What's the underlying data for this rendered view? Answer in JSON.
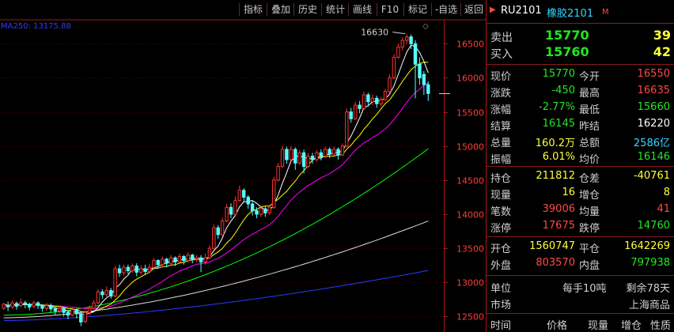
{
  "toolbar": {
    "items": [
      "指标",
      "叠加",
      "历史",
      "统计",
      "画线",
      "F10",
      "标记",
      "-自选",
      "返回"
    ]
  },
  "instrument": {
    "code": "RU2101",
    "name": "橡胶2101",
    "flag": "M"
  },
  "orderbook": {
    "sell_label": "卖出",
    "sell_price": "15770",
    "sell_vol": "39",
    "buy_label": "买入",
    "buy_price": "15760",
    "buy_vol": "42"
  },
  "quote": [
    {
      "l1": "现价",
      "v1": "15770",
      "c1": "green",
      "l2": "今开",
      "v2": "16550",
      "c2": "red"
    },
    {
      "l1": "涨跌",
      "v1": "-450",
      "c1": "green",
      "l2": "最高",
      "v2": "16635",
      "c2": "red"
    },
    {
      "l1": "涨幅",
      "v1": "-2.77%",
      "c1": "green",
      "l2": "最低",
      "v2": "15660",
      "c2": "green"
    },
    {
      "l1": "结算",
      "v1": "16145",
      "c1": "green",
      "l2": "昨结",
      "v2": "16220",
      "c2": "white"
    },
    {
      "l1": "总量",
      "v1": "160.2万",
      "c1": "yellow",
      "l2": "总额",
      "v2": "2586亿",
      "c2": "cyan"
    },
    {
      "l1": "振幅",
      "v1": "6.01%",
      "c1": "yellow",
      "l2": "均价",
      "v2": "16146",
      "c2": "green"
    }
  ],
  "position": [
    {
      "l1": "持仓",
      "v1": "211812",
      "c1": "yellow",
      "l2": "仓差",
      "v2": "-40761",
      "c2": "yellow"
    },
    {
      "l1": "现量",
      "v1": "16",
      "c1": "yellow",
      "l2": "增仓",
      "v2": "8",
      "c2": "yellow"
    },
    {
      "l1": "笔数",
      "v1": "39006",
      "c1": "red",
      "l2": "均量",
      "v2": "41",
      "c2": "red"
    },
    {
      "l1": "涨停",
      "v1": "17675",
      "c1": "red",
      "l2": "跌停",
      "v2": "14760",
      "c2": "green"
    }
  ],
  "trade": [
    {
      "l1": "开仓",
      "v1": "1560747",
      "c1": "yellow",
      "l2": "平仓",
      "v2": "1642269",
      "c2": "yellow"
    },
    {
      "l1": "外盘",
      "v1": "803570",
      "c1": "red",
      "l2": "内盘",
      "v2": "797938",
      "c2": "green"
    }
  ],
  "info": {
    "unit_label": "单位",
    "unit_value": "每手10吨",
    "remain_value": "剩余78天",
    "market_label": "市场",
    "market_value": "上海商品"
  },
  "ticks_header": [
    "时间",
    "价格",
    "现量",
    "增仓",
    "性质"
  ],
  "colors": {
    "up": "#ff3232",
    "down": "#54ffff",
    "ma5": "#ffffff",
    "ma10": "#ffff00",
    "ma20": "#ff00ff",
    "ma60": "#00ff00",
    "ma120": "#dcdcdc",
    "ma250": "#2a3cff",
    "border": "#b01414"
  },
  "chart_data": {
    "type": "candlestick",
    "ma_label": "MA250: 13175.88",
    "high_marker": "16630",
    "y_ticks": [
      12500,
      13000,
      13500,
      14000,
      14500,
      15000,
      15500,
      16000,
      16500
    ],
    "ylim": [
      12330,
      16840
    ],
    "last_price": 15770,
    "candles": [
      [
        12620,
        12680,
        12600,
        12700
      ],
      [
        12660,
        12640,
        12580,
        12720
      ],
      [
        12640,
        12700,
        12610,
        12740
      ],
      [
        12690,
        12650,
        12600,
        12720
      ],
      [
        12660,
        12700,
        12630,
        12760
      ],
      [
        12700,
        12680,
        12620,
        12730
      ],
      [
        12680,
        12640,
        12590,
        12700
      ],
      [
        12650,
        12700,
        12620,
        12730
      ],
      [
        12700,
        12660,
        12610,
        12720
      ],
      [
        12660,
        12620,
        12570,
        12680
      ],
      [
        12620,
        12660,
        12580,
        12700
      ],
      [
        12660,
        12610,
        12560,
        12690
      ],
      [
        12610,
        12580,
        12520,
        12640
      ],
      [
        12580,
        12620,
        12540,
        12660
      ],
      [
        12620,
        12560,
        12500,
        12640
      ],
      [
        12560,
        12520,
        12460,
        12590
      ],
      [
        12520,
        12600,
        12500,
        12640
      ],
      [
        12600,
        12540,
        12470,
        12620
      ],
      [
        12540,
        12420,
        12360,
        12570
      ],
      [
        12430,
        12560,
        12400,
        12600
      ],
      [
        12560,
        12620,
        12520,
        12660
      ],
      [
        12620,
        12700,
        12600,
        12740
      ],
      [
        12700,
        12860,
        12680,
        12900
      ],
      [
        12860,
        12820,
        12760,
        12900
      ],
      [
        12820,
        12880,
        12790,
        12940
      ],
      [
        12880,
        12800,
        12760,
        12920
      ],
      [
        12800,
        13200,
        12780,
        13240
      ],
      [
        13200,
        13140,
        13080,
        13260
      ],
      [
        13140,
        13220,
        13100,
        13260
      ],
      [
        13220,
        13170,
        13120,
        13260
      ],
      [
        13170,
        13240,
        13140,
        13280
      ],
      [
        13240,
        13150,
        13090,
        13280
      ],
      [
        13150,
        13200,
        13110,
        13250
      ],
      [
        13200,
        13160,
        13110,
        13260
      ],
      [
        13160,
        13220,
        13130,
        13270
      ],
      [
        13220,
        13320,
        13190,
        13360
      ],
      [
        13320,
        13260,
        13200,
        13340
      ],
      [
        13260,
        13340,
        13220,
        13380
      ],
      [
        13340,
        13280,
        13220,
        13360
      ],
      [
        13280,
        13360,
        13250,
        13400
      ],
      [
        13360,
        13300,
        13240,
        13380
      ],
      [
        13300,
        13380,
        13270,
        13420
      ],
      [
        13380,
        13320,
        13260,
        13400
      ],
      [
        13320,
        13400,
        13290,
        13440
      ],
      [
        13400,
        13340,
        13280,
        13420
      ],
      [
        13340,
        13360,
        13300,
        13400
      ],
      [
        13360,
        13300,
        13150,
        13400
      ],
      [
        13300,
        13360,
        13260,
        13420
      ],
      [
        13360,
        13500,
        13340,
        13540
      ],
      [
        13500,
        13800,
        13480,
        13850
      ],
      [
        13800,
        13700,
        13640,
        13840
      ],
      [
        13700,
        13900,
        13680,
        13950
      ],
      [
        13900,
        14100,
        13880,
        14150
      ],
      [
        14100,
        14000,
        13940,
        14160
      ],
      [
        14000,
        14200,
        13980,
        14260
      ],
      [
        14200,
        14350,
        14180,
        14420
      ],
      [
        14350,
        14250,
        14180,
        14380
      ],
      [
        14250,
        14150,
        14080,
        14280
      ],
      [
        14150,
        14050,
        13980,
        14200
      ],
      [
        14050,
        14000,
        13940,
        14100
      ],
      [
        14000,
        14080,
        13960,
        14120
      ],
      [
        14080,
        14020,
        13960,
        14120
      ],
      [
        14020,
        14100,
        13990,
        14140
      ],
      [
        14100,
        14500,
        14080,
        14550
      ],
      [
        14500,
        14700,
        14480,
        14750
      ],
      [
        14700,
        14950,
        14680,
        15000
      ],
      [
        14950,
        14800,
        14740,
        14990
      ],
      [
        14800,
        14950,
        14780,
        15000
      ],
      [
        14950,
        14750,
        14650,
        14980
      ],
      [
        14750,
        14900,
        14720,
        14940
      ],
      [
        14900,
        14700,
        14600,
        14950
      ],
      [
        14700,
        14850,
        14680,
        14900
      ],
      [
        14850,
        14800,
        14740,
        14900
      ],
      [
        14800,
        14900,
        14770,
        14940
      ],
      [
        14900,
        14850,
        14790,
        14950
      ],
      [
        14850,
        14950,
        14820,
        14990
      ],
      [
        14950,
        14880,
        14820,
        14980
      ],
      [
        14880,
        14950,
        14850,
        14990
      ],
      [
        14950,
        14870,
        14800,
        14980
      ],
      [
        14870,
        15000,
        14850,
        15040
      ],
      [
        15000,
        15500,
        14980,
        15550
      ],
      [
        15500,
        15400,
        15340,
        15560
      ],
      [
        15400,
        15600,
        15380,
        15650
      ],
      [
        15600,
        15550,
        15480,
        15660
      ],
      [
        15550,
        15750,
        15530,
        15800
      ],
      [
        15750,
        15650,
        15580,
        15780
      ],
      [
        15650,
        15700,
        15600,
        15760
      ],
      [
        15700,
        15620,
        15560,
        15740
      ],
      [
        15620,
        15680,
        15580,
        15720
      ],
      [
        15680,
        15800,
        15660,
        15840
      ],
      [
        15800,
        16000,
        15780,
        16050
      ],
      [
        16000,
        16300,
        15980,
        16350
      ],
      [
        16300,
        16450,
        16280,
        16500
      ],
      [
        16450,
        16550,
        16400,
        16600
      ],
      [
        16550,
        16600,
        16500,
        16635
      ],
      [
        16600,
        16500,
        16420,
        16635
      ],
      [
        16500,
        16200,
        15700,
        16550
      ],
      [
        16200,
        16000,
        15900,
        16300
      ],
      [
        16050,
        15900,
        15750,
        16100
      ],
      [
        15900,
        15770,
        15660,
        15950
      ]
    ]
  }
}
